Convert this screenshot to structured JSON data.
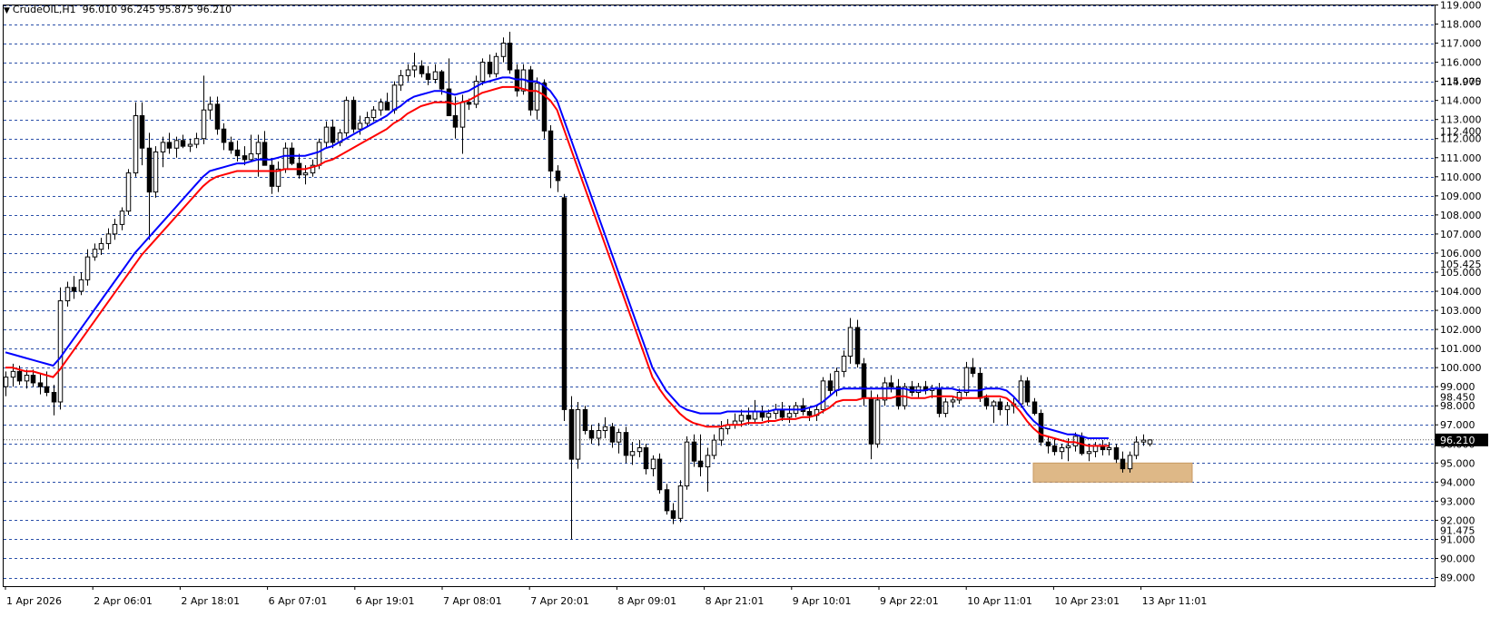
{
  "header": {
    "symbol": "CrudeOIL,H1",
    "ohlc": "96.010 96.245 95.875 96.210"
  },
  "colors": {
    "background": "#ffffff",
    "grid": "#2a4fa8",
    "bull_candle_body": "#ffffff",
    "bear_candle_body": "#000000",
    "candle_outline": "#000000",
    "ma_fast": "#0000ff",
    "ma_slow": "#ff0000",
    "zone": "#deb887"
  },
  "chart_data": {
    "type": "candlestick",
    "timeframe": "H1",
    "ylim": [
      89.0,
      119.0
    ],
    "y_ticks": [
      "119.000",
      "118.000",
      "117.000",
      "116.000",
      "115.000",
      "114.000",
      "113.000",
      "112.000",
      "111.000",
      "110.000",
      "109.000",
      "108.000",
      "107.000",
      "106.000",
      "105.000",
      "104.000",
      "103.000",
      "102.000",
      "101.000",
      "100.000",
      "99.000",
      "98.000",
      "97.000",
      "96.000",
      "95.000",
      "94.000",
      "93.000",
      "92.000",
      "91.000",
      "90.000",
      "89.000"
    ],
    "y_overlay_labels": [
      {
        "text": "114.975",
        "value": 114.975
      },
      {
        "text": "112.400",
        "value": 112.4
      },
      {
        "text": "105.425",
        "value": 105.425
      },
      {
        "text": "98.450",
        "value": 98.45
      },
      {
        "text": "91.475",
        "value": 91.475
      }
    ],
    "current_price": {
      "text": "96.210",
      "value": 96.21
    },
    "x_labels": [
      "1 Apr 2026",
      "2 Apr 06:01",
      "2 Apr 18:01",
      "6 Apr 07:01",
      "6 Apr 19:01",
      "7 Apr 08:01",
      "7 Apr 20:01",
      "8 Apr 09:01",
      "8 Apr 21:01",
      "9 Apr 10:01",
      "9 Apr 22:01",
      "10 Apr 11:01",
      "10 Apr 23:01",
      "13 Apr 11:01"
    ],
    "grid": true,
    "candles": [
      [
        99.0,
        99.8,
        98.5,
        99.5
      ],
      [
        99.5,
        100.2,
        99.0,
        99.8
      ],
      [
        99.8,
        100.1,
        99.1,
        99.3
      ],
      [
        99.3,
        99.9,
        98.9,
        99.6
      ],
      [
        99.6,
        99.9,
        99.0,
        99.2
      ],
      [
        99.2,
        99.7,
        98.6,
        99.0
      ],
      [
        99.0,
        99.8,
        98.5,
        98.7
      ],
      [
        98.7,
        99.1,
        97.5,
        98.2
      ],
      [
        98.2,
        104.2,
        97.8,
        103.5
      ],
      [
        103.5,
        104.5,
        103.2,
        104.2
      ],
      [
        104.2,
        104.8,
        103.6,
        104.0
      ],
      [
        104.0,
        105.0,
        103.8,
        104.6
      ],
      [
        104.6,
        106.2,
        104.3,
        105.8
      ],
      [
        105.8,
        106.5,
        105.6,
        106.2
      ],
      [
        106.2,
        106.8,
        105.9,
        106.5
      ],
      [
        106.5,
        107.3,
        106.2,
        107.0
      ],
      [
        107.0,
        107.8,
        106.7,
        107.5
      ],
      [
        107.5,
        108.4,
        107.2,
        108.2
      ],
      [
        108.2,
        110.4,
        108.0,
        110.2
      ],
      [
        110.2,
        113.9,
        110.0,
        113.2
      ],
      [
        113.2,
        113.9,
        110.6,
        111.5
      ],
      [
        111.5,
        112.3,
        106.7,
        109.2
      ],
      [
        109.2,
        111.6,
        108.9,
        111.3
      ],
      [
        111.3,
        112.1,
        110.5,
        111.8
      ],
      [
        111.8,
        112.3,
        111.2,
        111.5
      ],
      [
        111.5,
        112.1,
        111.0,
        111.9
      ],
      [
        111.9,
        112.2,
        111.5,
        111.6
      ],
      [
        111.6,
        112.0,
        111.3,
        111.7
      ],
      [
        111.7,
        112.3,
        111.5,
        112.0
      ],
      [
        112.0,
        115.3,
        111.7,
        113.5
      ],
      [
        113.5,
        114.2,
        113.0,
        113.8
      ],
      [
        113.8,
        114.2,
        112.2,
        112.5
      ],
      [
        112.5,
        112.8,
        111.4,
        111.8
      ],
      [
        111.8,
        112.1,
        111.2,
        111.4
      ],
      [
        111.4,
        111.9,
        110.8,
        111.1
      ],
      [
        111.1,
        111.6,
        110.6,
        110.9
      ],
      [
        110.9,
        112.2,
        110.8,
        111.2
      ],
      [
        111.2,
        112.2,
        110.0,
        111.8
      ],
      [
        111.8,
        112.4,
        110.6,
        110.6
      ],
      [
        110.6,
        110.9,
        109.1,
        109.5
      ],
      [
        109.5,
        110.8,
        109.2,
        110.4
      ],
      [
        110.4,
        111.8,
        110.2,
        111.5
      ],
      [
        111.5,
        111.8,
        110.6,
        110.7
      ],
      [
        110.7,
        111.2,
        109.9,
        110.1
      ],
      [
        110.1,
        110.6,
        109.6,
        110.2
      ],
      [
        110.2,
        110.9,
        110.0,
        110.6
      ],
      [
        110.6,
        112.0,
        110.4,
        111.8
      ],
      [
        111.8,
        112.9,
        111.5,
        112.6
      ],
      [
        112.6,
        113.0,
        111.5,
        111.8
      ],
      [
        111.8,
        112.5,
        111.6,
        112.3
      ],
      [
        112.3,
        114.2,
        112.1,
        114.0
      ],
      [
        114.0,
        114.2,
        112.3,
        112.5
      ],
      [
        112.5,
        113.2,
        112.2,
        112.8
      ],
      [
        112.8,
        113.4,
        112.6,
        113.1
      ],
      [
        113.1,
        113.7,
        112.9,
        113.5
      ],
      [
        113.5,
        114.1,
        113.2,
        113.9
      ],
      [
        113.9,
        114.4,
        113.6,
        113.5
      ],
      [
        113.5,
        115.0,
        113.3,
        114.8
      ],
      [
        114.8,
        115.6,
        114.5,
        115.3
      ],
      [
        115.3,
        115.9,
        115.0,
        115.6
      ],
      [
        115.6,
        116.5,
        115.2,
        115.8
      ],
      [
        115.8,
        116.1,
        115.2,
        115.4
      ],
      [
        115.4,
        115.8,
        114.8,
        115.1
      ],
      [
        115.1,
        115.9,
        114.9,
        115.5
      ],
      [
        115.5,
        115.6,
        114.3,
        114.6
      ],
      [
        114.6,
        116.2,
        114.0,
        113.2
      ],
      [
        113.2,
        114.2,
        112.0,
        112.6
      ],
      [
        112.6,
        114.3,
        111.2,
        113.9
      ],
      [
        113.9,
        114.1,
        113.5,
        113.8
      ],
      [
        113.8,
        115.3,
        113.6,
        115.0
      ],
      [
        115.0,
        116.2,
        114.8,
        116.0
      ],
      [
        116.0,
        116.4,
        115.2,
        115.4
      ],
      [
        115.4,
        116.5,
        115.2,
        116.3
      ],
      [
        116.3,
        117.3,
        116.0,
        117.0
      ],
      [
        117.0,
        117.6,
        115.4,
        115.6
      ],
      [
        115.6,
        115.9,
        114.2,
        114.5
      ],
      [
        114.5,
        115.9,
        114.3,
        115.6
      ],
      [
        115.6,
        115.8,
        113.2,
        113.5
      ],
      [
        113.5,
        115.2,
        113.0,
        114.9
      ],
      [
        114.9,
        115.1,
        112.0,
        112.4
      ],
      [
        112.4,
        112.7,
        109.4,
        110.3
      ],
      [
        110.3,
        110.6,
        109.2,
        109.8
      ],
      [
        108.9,
        109.1,
        97.2,
        97.8
      ],
      [
        97.8,
        98.5,
        91.0,
        95.2
      ],
      [
        95.2,
        98.2,
        94.7,
        97.8
      ],
      [
        97.8,
        98.0,
        96.5,
        96.7
      ],
      [
        96.7,
        97.0,
        96.0,
        96.3
      ],
      [
        96.3,
        97.1,
        95.9,
        96.7
      ],
      [
        96.7,
        97.4,
        96.3,
        96.9
      ],
      [
        96.9,
        97.1,
        95.8,
        96.1
      ],
      [
        96.1,
        96.8,
        95.5,
        96.6
      ],
      [
        96.6,
        96.9,
        95.0,
        95.4
      ],
      [
        95.4,
        96.1,
        94.9,
        95.6
      ],
      [
        95.6,
        96.2,
        95.3,
        95.8
      ],
      [
        95.8,
        96.0,
        94.4,
        94.7
      ],
      [
        94.7,
        95.4,
        94.3,
        95.2
      ],
      [
        95.2,
        95.5,
        93.4,
        93.6
      ],
      [
        93.6,
        93.9,
        92.3,
        92.5
      ],
      [
        92.5,
        92.9,
        91.8,
        92.1
      ],
      [
        92.1,
        94.1,
        91.9,
        93.8
      ],
      [
        93.8,
        96.4,
        93.6,
        96.1
      ],
      [
        96.1,
        96.5,
        94.8,
        95.1
      ],
      [
        95.1,
        96.5,
        94.3,
        94.8
      ],
      [
        94.8,
        95.8,
        93.5,
        95.4
      ],
      [
        95.4,
        96.5,
        95.2,
        96.2
      ],
      [
        96.2,
        97.2,
        95.9,
        96.8
      ],
      [
        96.8,
        97.3,
        96.5,
        97.0
      ],
      [
        97.0,
        97.6,
        96.8,
        97.2
      ],
      [
        97.2,
        97.8,
        96.9,
        97.5
      ],
      [
        97.5,
        97.9,
        97.0,
        97.3
      ],
      [
        97.3,
        98.3,
        97.1,
        97.7
      ],
      [
        97.7,
        98.0,
        97.2,
        97.4
      ],
      [
        97.4,
        97.8,
        97.1,
        97.6
      ],
      [
        97.6,
        98.1,
        97.3,
        97.8
      ],
      [
        97.8,
        98.2,
        97.2,
        97.4
      ],
      [
        97.4,
        98.0,
        97.1,
        97.6
      ],
      [
        97.6,
        98.2,
        97.4,
        98.0
      ],
      [
        98.0,
        98.4,
        97.5,
        97.7
      ],
      [
        97.7,
        97.9,
        97.2,
        97.5
      ],
      [
        97.5,
        98.0,
        97.2,
        97.8
      ],
      [
        97.8,
        99.5,
        97.6,
        99.3
      ],
      [
        99.3,
        99.7,
        98.6,
        98.8
      ],
      [
        98.8,
        100.0,
        98.5,
        99.8
      ],
      [
        99.8,
        100.9,
        99.5,
        100.6
      ],
      [
        100.6,
        102.6,
        100.2,
        102.1
      ],
      [
        102.1,
        102.5,
        100.0,
        100.2
      ],
      [
        100.2,
        100.5,
        98.0,
        98.4
      ],
      [
        98.4,
        98.8,
        95.2,
        96.0
      ],
      [
        96.0,
        98.6,
        95.8,
        98.3
      ],
      [
        98.3,
        99.5,
        98.0,
        99.2
      ],
      [
        99.2,
        99.6,
        98.7,
        99.0
      ],
      [
        99.0,
        99.4,
        97.8,
        98.0
      ],
      [
        98.0,
        99.2,
        97.8,
        99.0
      ],
      [
        99.0,
        99.3,
        98.5,
        98.7
      ],
      [
        98.7,
        99.2,
        98.4,
        99.0
      ],
      [
        99.0,
        99.3,
        98.6,
        98.8
      ],
      [
        98.8,
        99.1,
        98.4,
        98.9
      ],
      [
        98.9,
        99.2,
        97.4,
        97.6
      ],
      [
        97.6,
        98.4,
        97.4,
        98.2
      ],
      [
        98.2,
        98.5,
        97.9,
        98.3
      ],
      [
        98.3,
        98.9,
        98.1,
        98.7
      ],
      [
        98.7,
        100.3,
        98.5,
        100.0
      ],
      [
        100.0,
        100.5,
        99.5,
        99.7
      ],
      [
        99.7,
        100.0,
        98.2,
        98.4
      ],
      [
        98.4,
        98.6,
        97.8,
        98.0
      ],
      [
        98.0,
        98.3,
        97.1,
        98.2
      ],
      [
        98.2,
        98.4,
        97.5,
        97.8
      ],
      [
        97.8,
        98.2,
        97.0,
        98.0
      ],
      [
        98.0,
        98.4,
        97.6,
        98.1
      ],
      [
        98.1,
        99.6,
        97.9,
        99.3
      ],
      [
        99.3,
        99.5,
        98.0,
        98.2
      ],
      [
        98.2,
        98.4,
        97.5,
        97.6
      ],
      [
        97.6,
        97.8,
        95.9,
        96.1
      ],
      [
        96.1,
        96.4,
        95.5,
        95.9
      ],
      [
        95.9,
        96.3,
        95.4,
        95.6
      ],
      [
        95.6,
        96.0,
        95.2,
        95.8
      ],
      [
        95.8,
        96.3,
        95.1,
        95.9
      ],
      [
        95.9,
        96.6,
        95.6,
        96.4
      ],
      [
        96.4,
        96.6,
        95.4,
        95.5
      ],
      [
        95.5,
        96.0,
        95.1,
        95.6
      ],
      [
        95.6,
        96.1,
        95.3,
        95.9
      ],
      [
        95.9,
        96.2,
        95.4,
        95.7
      ],
      [
        95.7,
        96.1,
        95.4,
        95.8
      ],
      [
        95.8,
        96.0,
        95.0,
        95.2
      ],
      [
        95.2,
        95.6,
        94.5,
        94.7
      ],
      [
        94.7,
        95.6,
        94.5,
        95.4
      ],
      [
        95.4,
        96.4,
        95.2,
        96.1
      ],
      [
        96.1,
        96.5,
        95.9,
        96.2
      ],
      [
        96.0,
        96.245,
        95.875,
        96.21
      ]
    ],
    "ma_fast": [
      100.8,
      100.7,
      100.6,
      100.5,
      100.4,
      100.3,
      100.2,
      100.1,
      100.5,
      101.0,
      101.5,
      102.0,
      102.5,
      103.0,
      103.5,
      104.0,
      104.5,
      105.0,
      105.5,
      106.0,
      106.4,
      106.8,
      107.2,
      107.6,
      108.0,
      108.4,
      108.8,
      109.2,
      109.6,
      110.0,
      110.3,
      110.4,
      110.5,
      110.6,
      110.7,
      110.7,
      110.8,
      110.9,
      110.9,
      110.9,
      111.0,
      111.1,
      111.1,
      111.1,
      111.1,
      111.2,
      111.3,
      111.5,
      111.6,
      111.8,
      112.0,
      112.2,
      112.4,
      112.6,
      112.8,
      113.0,
      113.2,
      113.5,
      113.7,
      114.0,
      114.2,
      114.3,
      114.4,
      114.5,
      114.5,
      114.4,
      114.3,
      114.4,
      114.5,
      114.7,
      114.9,
      115.0,
      115.1,
      115.2,
      115.2,
      115.1,
      115.1,
      115.0,
      115.0,
      114.8,
      114.5,
      114.0,
      113.0,
      112.0,
      111.0,
      110.0,
      109.0,
      108.0,
      107.0,
      106.0,
      105.0,
      104.0,
      103.0,
      102.0,
      101.0,
      100.0,
      99.4,
      98.8,
      98.4,
      98.0,
      97.8,
      97.7,
      97.6,
      97.6,
      97.6,
      97.6,
      97.7,
      97.7,
      97.7,
      97.7,
      97.7,
      97.7,
      97.7,
      97.8,
      97.8,
      97.8,
      97.8,
      97.8,
      97.9,
      98.0,
      98.2,
      98.5,
      98.8,
      98.9,
      98.9,
      98.9,
      98.9,
      98.9,
      98.9,
      98.9,
      98.9,
      98.9,
      98.9,
      98.8,
      98.8,
      98.8,
      98.9,
      98.9,
      98.9,
      98.9,
      98.8,
      98.8,
      98.8,
      98.8,
      98.9,
      98.9,
      98.9,
      98.8,
      98.5,
      98.1,
      97.6,
      97.2,
      96.9,
      96.8,
      96.7,
      96.6,
      96.5,
      96.5,
      96.4,
      96.3,
      96.3,
      96.3,
      96.3
    ],
    "ma_slow": [
      100.0,
      100.0,
      99.9,
      99.8,
      99.8,
      99.7,
      99.6,
      99.5,
      99.9,
      100.4,
      100.9,
      101.4,
      101.9,
      102.4,
      102.9,
      103.4,
      103.9,
      104.4,
      104.9,
      105.4,
      105.9,
      106.3,
      106.7,
      107.1,
      107.5,
      107.9,
      108.3,
      108.7,
      109.1,
      109.5,
      109.8,
      110.0,
      110.1,
      110.2,
      110.3,
      110.3,
      110.3,
      110.3,
      110.3,
      110.3,
      110.3,
      110.4,
      110.4,
      110.4,
      110.4,
      110.5,
      110.6,
      110.8,
      110.9,
      111.1,
      111.3,
      111.5,
      111.7,
      111.9,
      112.1,
      112.3,
      112.5,
      112.8,
      113.0,
      113.3,
      113.5,
      113.7,
      113.8,
      113.9,
      113.9,
      113.9,
      113.8,
      113.9,
      114.0,
      114.2,
      114.4,
      114.5,
      114.6,
      114.7,
      114.7,
      114.7,
      114.6,
      114.5,
      114.5,
      114.3,
      114.0,
      113.5,
      112.5,
      111.5,
      110.5,
      109.5,
      108.5,
      107.5,
      106.5,
      105.5,
      104.5,
      103.5,
      102.5,
      101.5,
      100.5,
      99.5,
      98.9,
      98.4,
      98.0,
      97.6,
      97.3,
      97.1,
      97.0,
      96.9,
      96.9,
      96.9,
      97.0,
      97.0,
      97.0,
      97.1,
      97.1,
      97.1,
      97.2,
      97.2,
      97.3,
      97.3,
      97.3,
      97.4,
      97.4,
      97.5,
      97.7,
      97.9,
      98.2,
      98.3,
      98.3,
      98.3,
      98.4,
      98.4,
      98.4,
      98.4,
      98.4,
      98.5,
      98.5,
      98.4,
      98.4,
      98.4,
      98.5,
      98.5,
      98.5,
      98.5,
      98.4,
      98.4,
      98.4,
      98.4,
      98.5,
      98.5,
      98.5,
      98.4,
      98.1,
      97.7,
      97.2,
      96.8,
      96.5,
      96.4,
      96.3,
      96.2,
      96.1,
      96.1,
      96.0,
      95.9,
      95.9,
      95.9,
      95.9
    ],
    "support_zone": {
      "from": 94.0,
      "to": 95.0
    },
    "series": [
      {
        "name": "",
        "type": "candles"
      },
      {
        "name": "",
        "type": "line",
        "color": "#0000ff"
      },
      {
        "name": "",
        "type": "line",
        "color": "#ff0000"
      }
    ]
  }
}
